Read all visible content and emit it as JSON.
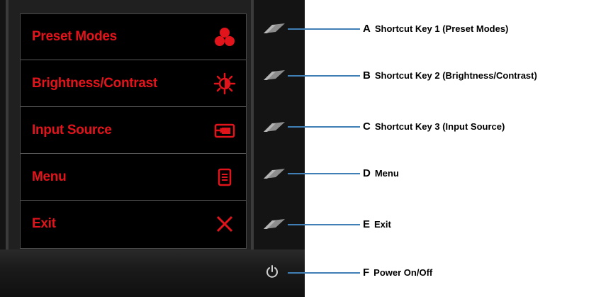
{
  "osd_menu": {
    "items": [
      {
        "label": "Preset Modes",
        "icon": "preset-modes-icon"
      },
      {
        "label": "Brightness/Contrast",
        "icon": "brightness-icon"
      },
      {
        "label": "Input Source",
        "icon": "input-source-icon"
      },
      {
        "label": "Menu",
        "icon": "menu-icon"
      },
      {
        "label": "Exit",
        "icon": "close-icon"
      }
    ]
  },
  "callouts": [
    {
      "letter": "A",
      "text": "Shortcut Key 1 (Preset Modes)"
    },
    {
      "letter": "B",
      "text": "Shortcut Key 2 (Brightness/Contrast)"
    },
    {
      "letter": "C",
      "text": "Shortcut Key 3 (Input Source)"
    },
    {
      "letter": "D",
      "text": "Menu"
    },
    {
      "letter": "E",
      "text": "Exit"
    },
    {
      "letter": "F",
      "text": "Power On/Off"
    }
  ],
  "colors": {
    "osd_text": "#e1141b",
    "callout_line": "#3f7fb5",
    "bezel": "#141414"
  }
}
